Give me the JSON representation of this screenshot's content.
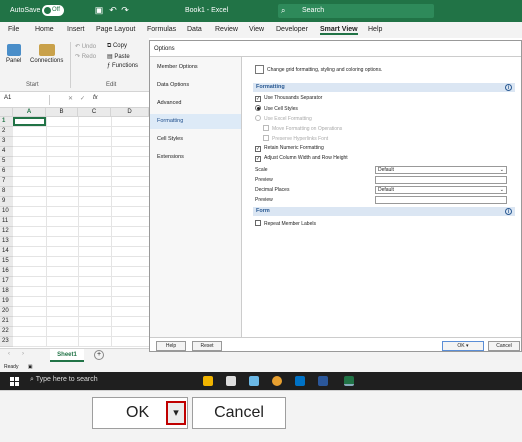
{
  "titlebar": {
    "autosave": "AutoSave",
    "autosave_state": "Off",
    "book_title": "Book1 - Excel",
    "search": "Search"
  },
  "menu": [
    "File",
    "Home",
    "Insert",
    "Page Layout",
    "Formulas",
    "Data",
    "Review",
    "View",
    "Developer",
    "Smart View",
    "Help"
  ],
  "menu_active": "Smart View",
  "ribbon": {
    "panel": "Panel",
    "connections": "Connections",
    "start_group": "Start",
    "undo": "Undo",
    "redo": "Redo",
    "copy": "Copy",
    "paste": "Paste",
    "functions": "Functions",
    "edit_group": "Edit"
  },
  "formula_bar": {
    "name_box": "A1",
    "fx": "fx"
  },
  "grid": {
    "columns": [
      "A",
      "B",
      "C",
      "D"
    ],
    "rows": [
      "1",
      "2",
      "3",
      "4",
      "5",
      "6",
      "7",
      "8",
      "9",
      "10",
      "11",
      "12",
      "13",
      "14",
      "15",
      "16",
      "17",
      "18",
      "19",
      "20",
      "21",
      "22",
      "23"
    ]
  },
  "sheet": {
    "tab": "Sheet1",
    "add": "+"
  },
  "status": {
    "ready": "Ready"
  },
  "taskbar": {
    "search": "Type here to search"
  },
  "dialog": {
    "title": "Options",
    "side_items": [
      "Member Options",
      "Data Options",
      "Advanced",
      "Formatting",
      "Cell Styles",
      "Extensions"
    ],
    "selected": "Formatting",
    "hint": "Change grid formatting, styling and coloring options.",
    "section_formatting": "Formatting",
    "use_thousands": "Use Thousands Separator",
    "use_cell_styles": "Use Cell Styles",
    "use_excel_formatting": "Use Excel Formatting",
    "move_formatting": "Move Formatting on Operations",
    "preserve_hyperlinks": "Preserve Hyperlinks Font",
    "retain_numeric": "Retain Numeric Formatting",
    "adjust_column": "Adjust Column Width and Row Height",
    "scale_label": "Scale",
    "scale_value": "Default",
    "preview1": "Preview",
    "decimal_label": "Decimal Places",
    "decimal_value": "Default",
    "preview2": "Preview",
    "section_form": "Form",
    "repeat_member": "Repeat Member Labels",
    "help": "Help",
    "reset": "Reset",
    "ok": "OK",
    "cancel": "Cancel"
  },
  "zoom": {
    "ok": "OK",
    "cancel": "Cancel"
  }
}
